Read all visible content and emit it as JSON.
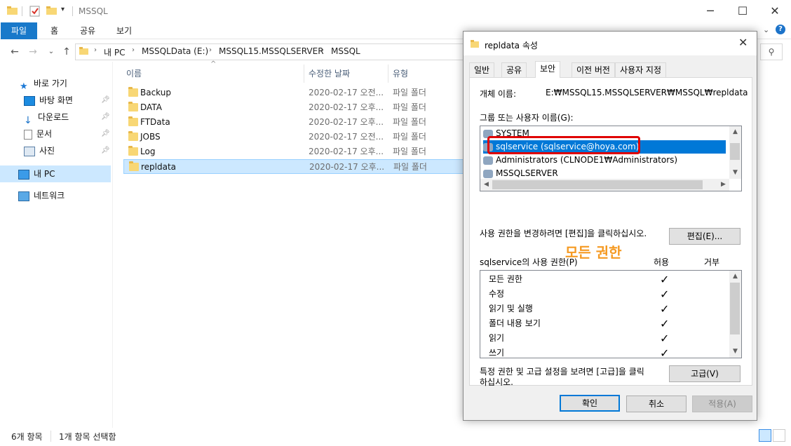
{
  "explorer": {
    "title": "MSSQL",
    "ribbon_tabs": [
      "파일",
      "홈",
      "공유",
      "보기"
    ],
    "breadcrumb": [
      "내 PC",
      "MSSQLData (E:)",
      "MSSQL15.MSSQLSERVER",
      "MSSQL"
    ],
    "columns": {
      "name": "이름",
      "date": "수정한 날짜",
      "type": "유형"
    },
    "nav": {
      "quick_access": "바로 가기",
      "desktop": "바탕 화면",
      "downloads": "다운로드",
      "documents": "문서",
      "pictures": "사진",
      "this_pc": "내 PC",
      "network": "네트워크"
    },
    "files": [
      {
        "name": "Backup",
        "date": "2020-02-17 오전...",
        "type": "파일 폴더"
      },
      {
        "name": "DATA",
        "date": "2020-02-17 오후...",
        "type": "파일 폴더"
      },
      {
        "name": "FTData",
        "date": "2020-02-17 오후...",
        "type": "파일 폴더"
      },
      {
        "name": "JOBS",
        "date": "2020-02-17 오전...",
        "type": "파일 폴더"
      },
      {
        "name": "Log",
        "date": "2020-02-17 오후...",
        "type": "파일 폴더"
      },
      {
        "name": "repldata",
        "date": "2020-02-17 오후...",
        "type": "파일 폴더"
      }
    ],
    "status": {
      "count": "6개 항목",
      "selected": "1개 항목 선택함"
    }
  },
  "dialog": {
    "title": "repldata 속성",
    "tabs": [
      "일반",
      "공유",
      "보안",
      "이전 버전",
      "사용자 지정"
    ],
    "active_tab": "보안",
    "object_name_label": "개체 이름:",
    "object_name_value": "E:₩MSSQL15.MSSQLSERVER₩MSSQL₩repldata",
    "group_label": "그룹 또는 사용자 이름(G):",
    "users": [
      "SYSTEM",
      "sqlservice (sqlservice@hoya.com)",
      "Administrators (CLNODE1₩Administrators)",
      "MSSQLSERVER"
    ],
    "selected_user": "sqlservice (sqlservice@hoya.com)",
    "edit_hint": "사용 권한을 변경하려면 [편집]을 클릭하십시오.",
    "edit_button": "편집(E)...",
    "perm_label": "sqlservice의 사용 권한(P)",
    "allow_label": "허용",
    "deny_label": "거부",
    "permissions": [
      "모든 권한",
      "수정",
      "읽기 및 실행",
      "폴더 내용 보기",
      "읽기",
      "쓰기"
    ],
    "advanced_hint_1": "특정 권한 및 고급 설정을 보려면 [고급]을 클릭",
    "advanced_hint_2": "하십시오.",
    "advanced_button": "고급(V)",
    "ok_button": "확인",
    "cancel_button": "취소",
    "apply_button": "적용(A)"
  },
  "annotation": "모든 권한",
  "colors": {
    "accent": "#0078d7",
    "file_tab": "#1979ca",
    "highlight": "#e00000",
    "annotation": "#f59a23",
    "selection": "#cce8ff"
  }
}
